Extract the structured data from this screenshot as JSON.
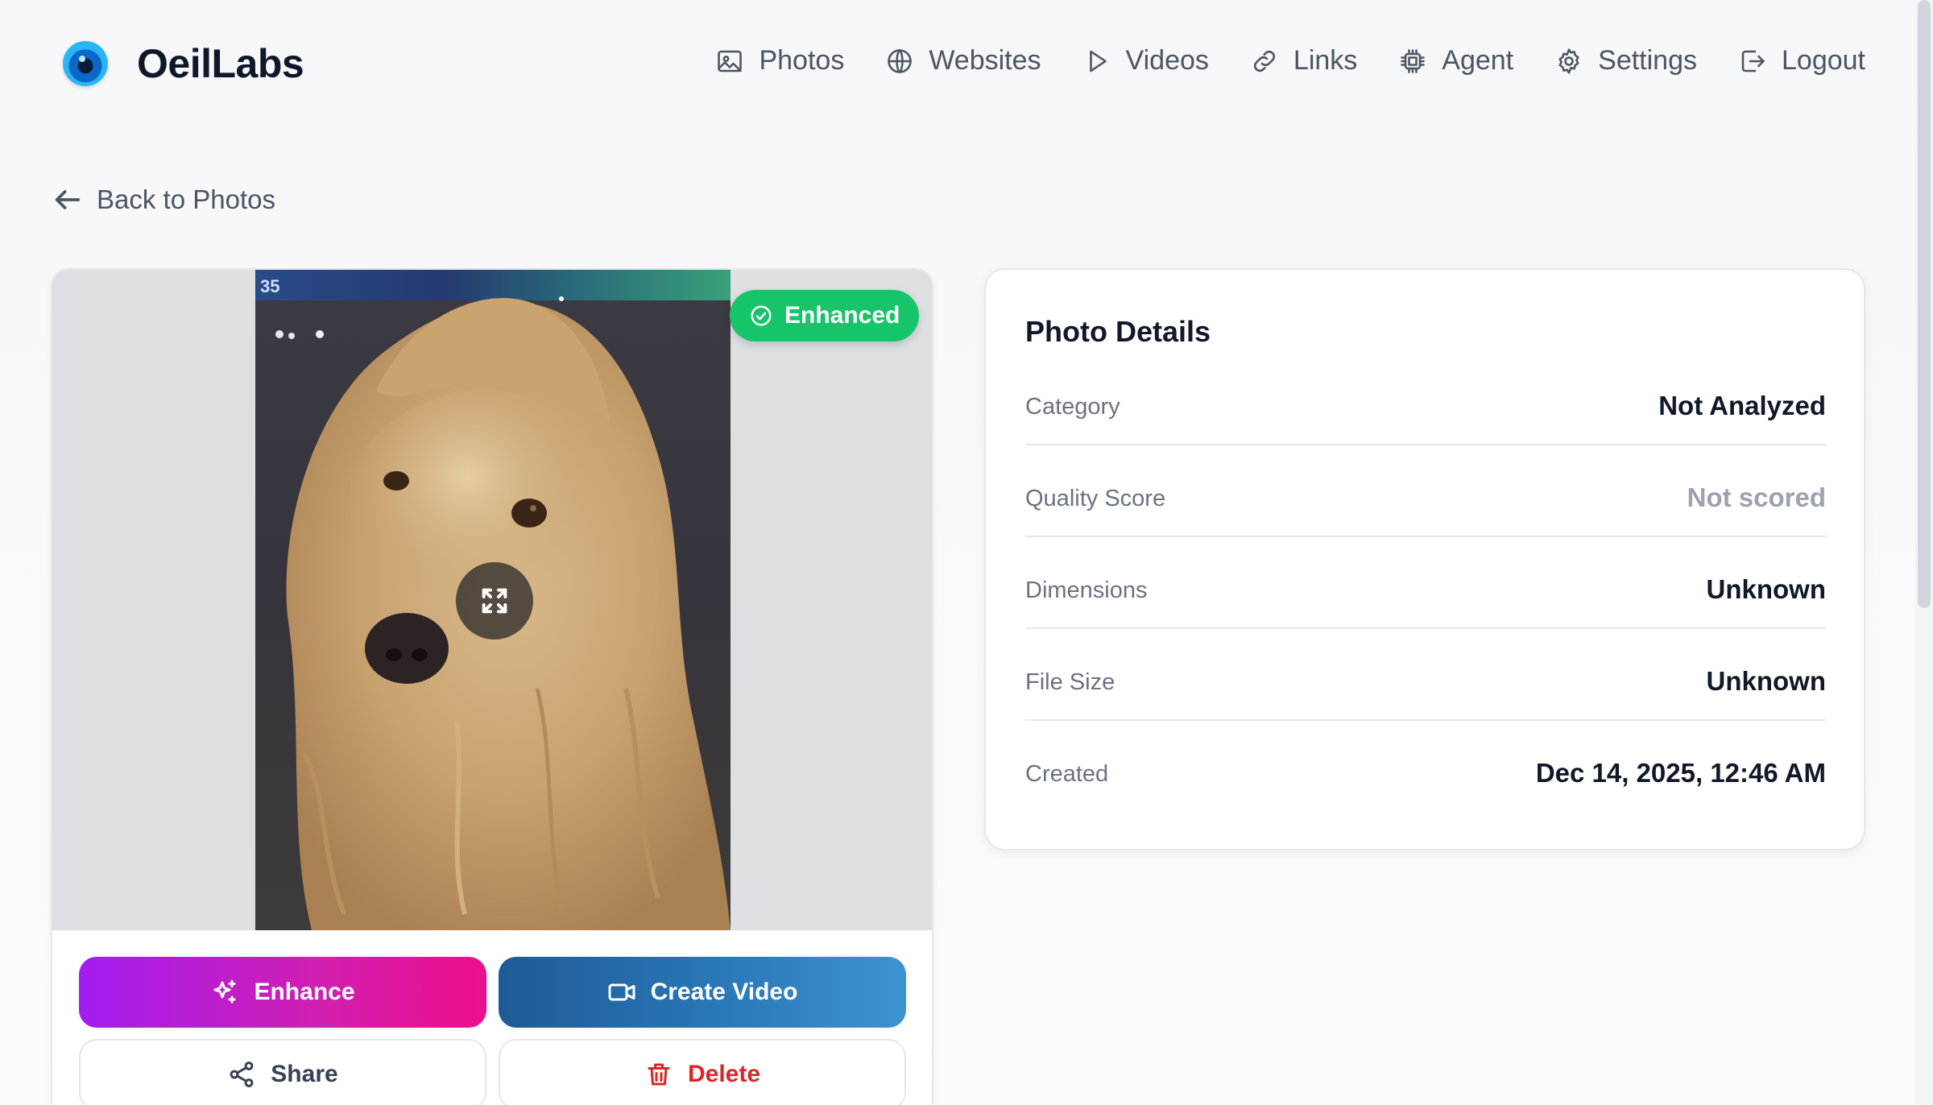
{
  "app": {
    "name": "OeilLabs"
  },
  "nav": {
    "items": [
      {
        "label": "Photos",
        "icon": "image-icon"
      },
      {
        "label": "Websites",
        "icon": "globe-icon"
      },
      {
        "label": "Videos",
        "icon": "play-icon"
      },
      {
        "label": "Links",
        "icon": "link-icon"
      },
      {
        "label": "Agent",
        "icon": "chip-icon"
      },
      {
        "label": "Settings",
        "icon": "gear-icon"
      },
      {
        "label": "Logout",
        "icon": "logout-icon"
      }
    ]
  },
  "back": {
    "label": "Back to Photos"
  },
  "photo": {
    "badge": "Enhanced",
    "badge_color": "#16c46a",
    "scoreboard_text": "35"
  },
  "actions": {
    "enhance": "Enhance",
    "create_video": "Create Video",
    "share": "Share",
    "delete": "Delete"
  },
  "details": {
    "title": "Photo Details",
    "rows": [
      {
        "label": "Category",
        "value": "Not Analyzed"
      },
      {
        "label": "Quality Score",
        "value": "Not scored"
      },
      {
        "label": "Dimensions",
        "value": "Unknown"
      },
      {
        "label": "File Size",
        "value": "Unknown"
      },
      {
        "label": "Created",
        "value": "Dec 14, 2025, 12:46 AM"
      }
    ]
  }
}
